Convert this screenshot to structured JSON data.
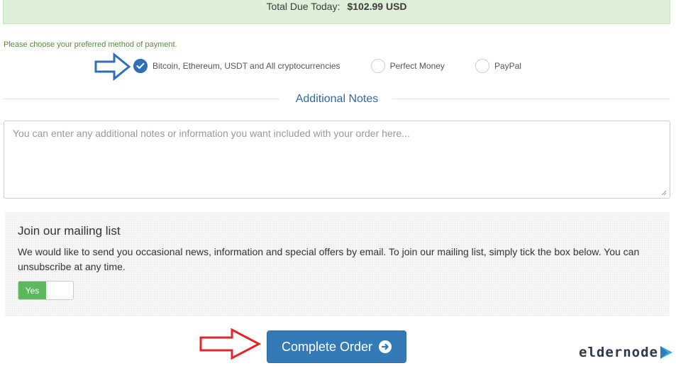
{
  "order_summary": {
    "total_label": "Total Due Today:",
    "total_amount": "$102.99 USD"
  },
  "payment": {
    "prompt": "Please choose your preferred method of payment.",
    "options": [
      {
        "label": "Bitcoin, Ethereum, USDT and All cryptocurrencies",
        "selected": true
      },
      {
        "label": "Perfect Money",
        "selected": false
      },
      {
        "label": "PayPal",
        "selected": false
      }
    ]
  },
  "notes": {
    "title": "Additional Notes",
    "placeholder": "You can enter any additional notes or information you want included with your order here..."
  },
  "mailing": {
    "title": "Join our mailing list",
    "description": "We would like to send you occasional news, information and special offers by email. To join our mailing list, simply tick the box below. You can unsubscribe at any time.",
    "toggle_label": "Yes",
    "toggle_on": true
  },
  "actions": {
    "complete_order_label": "Complete Order"
  },
  "branding": {
    "logo_text": "eldernode"
  },
  "colors": {
    "primary": "#337ab7",
    "success": "#5cb85c",
    "total_bar_bg": "#dff0d8",
    "annotation_blue": "#2f6fb5",
    "annotation_red": "#e3262b"
  },
  "icons": {
    "selected_radio": "check-icon",
    "button_icon": "arrow-circle-right-icon",
    "annotations": [
      "blue-arrow-icon",
      "red-arrow-icon"
    ]
  }
}
